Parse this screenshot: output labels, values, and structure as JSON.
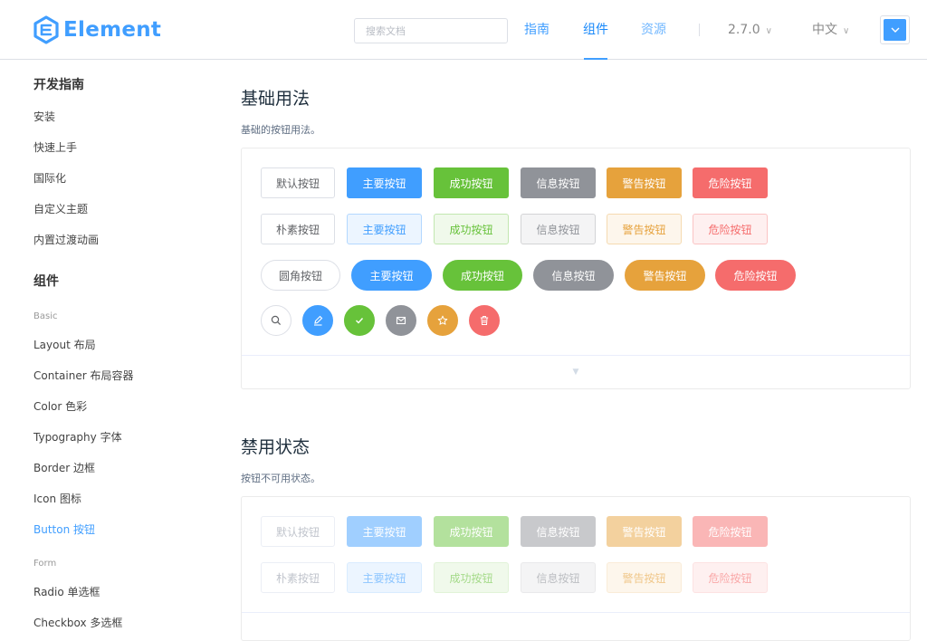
{
  "header": {
    "logo_text": "Element",
    "search_placeholder": "搜索文档",
    "nav": [
      "指南",
      "组件",
      "资源"
    ],
    "version": "2.7.0",
    "language": "中文",
    "active_nav": "组件",
    "accent_color": "#409eff"
  },
  "sidebar": {
    "group_dev": "开发指南",
    "dev_items": [
      "安装",
      "快速上手",
      "国际化",
      "自定义主题",
      "内置过渡动画"
    ],
    "group_components": "组件",
    "cat_basic": "Basic",
    "basic_items": [
      "Layout 布局",
      "Container 布局容器",
      "Color 色彩",
      "Typography 字体",
      "Border 边框",
      "Icon 图标",
      "Button 按钮"
    ],
    "active_item": "Button 按钮",
    "cat_form": "Form",
    "form_items": [
      "Radio 单选框",
      "Checkbox 多选框"
    ]
  },
  "section1": {
    "title": "基础用法",
    "desc": "基础的按钮用法。",
    "buttons": [
      "默认按钮",
      "主要按钮",
      "成功按钮",
      "信息按钮",
      "警告按钮",
      "危险按钮"
    ],
    "plain_buttons": [
      "朴素按钮",
      "主要按钮",
      "成功按钮",
      "信息按钮",
      "警告按钮",
      "危险按钮"
    ],
    "round_buttons": [
      "圆角按钮",
      "主要按钮",
      "成功按钮",
      "信息按钮",
      "警告按钮",
      "危险按钮"
    ],
    "circle_icons": [
      "search-icon",
      "edit-icon",
      "check-icon",
      "message-icon",
      "star-icon",
      "delete-icon"
    ]
  },
  "section2": {
    "title": "禁用状态",
    "desc": "按钮不可用状态。",
    "buttons": [
      "默认按钮",
      "主要按钮",
      "成功按钮",
      "信息按钮",
      "警告按钮",
      "危险按钮"
    ],
    "plain_buttons": [
      "朴素按钮",
      "主要按钮",
      "成功按钮",
      "信息按钮",
      "警告按钮",
      "危险按钮"
    ]
  },
  "colors": {
    "primary": "#409eff",
    "success": "#67c23a",
    "info": "#909399",
    "warning": "#e6a23c",
    "danger": "#f56c6c"
  }
}
